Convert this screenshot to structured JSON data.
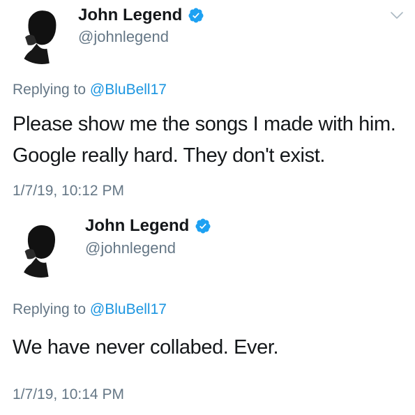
{
  "colors": {
    "text_primary": "#14171a",
    "text_secondary": "#657786",
    "link_blue": "#1b95e0",
    "verified_blue": "#1da1f2"
  },
  "tweets": [
    {
      "author": {
        "display_name": "John Legend",
        "handle": "@johnlegend",
        "verified": true,
        "avatar_icon": "profile-photo"
      },
      "reply_prefix": "Replying to",
      "reply_to": "@BluBell17",
      "text": "Please show me the songs I made with him. Google really hard. They don't exist.",
      "timestamp": "1/7/19, 10:12 PM",
      "menu_icon": "chevron-down-icon"
    },
    {
      "author": {
        "display_name": "John Legend",
        "handle": "@johnlegend",
        "verified": true,
        "avatar_icon": "profile-photo"
      },
      "reply_prefix": "Replying to",
      "reply_to": "@BluBell17",
      "text": "We have never collabed. Ever.",
      "timestamp": "1/7/19, 10:14 PM"
    }
  ]
}
